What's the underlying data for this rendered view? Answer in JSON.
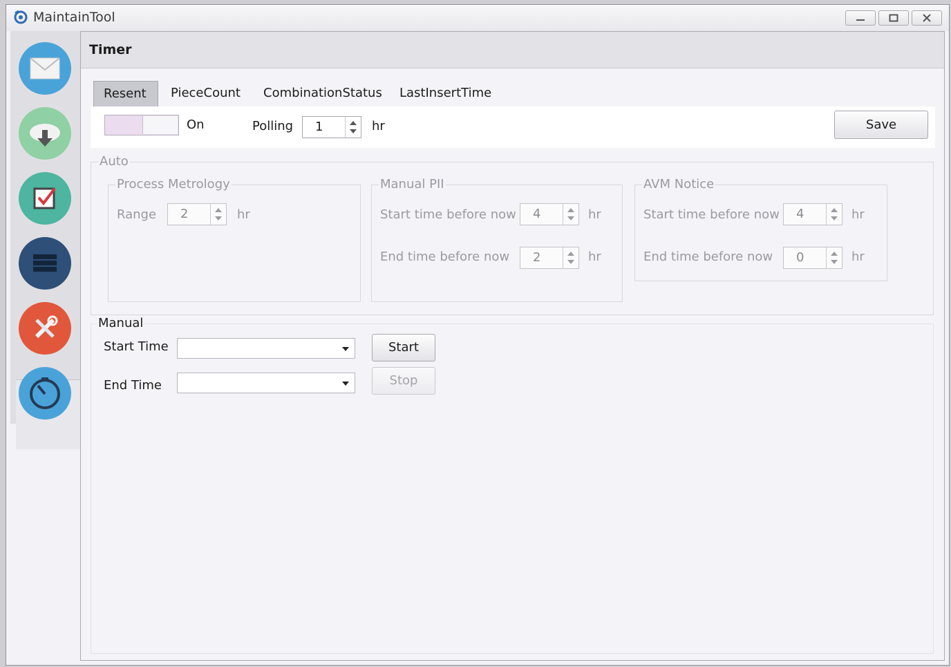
{
  "window": {
    "title": "MaintainTool",
    "controls": [
      "minimize",
      "maximize",
      "close"
    ]
  },
  "sidebar": {
    "items": [
      {
        "icon": "mail-icon",
        "color": "#4aa3d8"
      },
      {
        "icon": "cloud-download-icon",
        "color": "#8fd0a4"
      },
      {
        "icon": "checkbox-icon",
        "color": "#4db5a0"
      },
      {
        "icon": "server-list-icon",
        "color": "#2d4f78"
      },
      {
        "icon": "tools-icon",
        "color": "#e1573b"
      },
      {
        "icon": "timer-icon",
        "color": "#4aa3d8"
      }
    ]
  },
  "page": {
    "title": "Timer"
  },
  "tabs": [
    {
      "label": "Resent",
      "active": true
    },
    {
      "label": "PieceCount",
      "active": false
    },
    {
      "label": "CombinationStatus",
      "active": false
    },
    {
      "label": "LastInsertTime",
      "active": false
    }
  ],
  "toprow": {
    "toggle_label": "On",
    "polling_label": "Polling",
    "polling_value": "1",
    "polling_unit": "hr",
    "save_label": "Save"
  },
  "auto": {
    "title": "Auto",
    "process_metrology": {
      "title": "Process  Metrology",
      "range_label": "Range",
      "range_value": "2",
      "unit": "hr"
    },
    "manual_pii": {
      "title": "Manual PII",
      "start_label": "Start time before now",
      "start_value": "4",
      "end_label": "End time before now",
      "end_value": "2",
      "unit": "hr"
    },
    "avm_notice": {
      "title": "AVM Notice",
      "start_label": "Start time before now",
      "start_value": "4",
      "end_label": "End time before now",
      "end_value": "0",
      "unit": "hr"
    }
  },
  "manual": {
    "title": "Manual",
    "start_time_label": "Start Time",
    "start_time_value": "",
    "end_time_label": "End Time",
    "end_time_value": "",
    "start_button": "Start",
    "stop_button": "Stop"
  },
  "colors": {
    "toggle_track": "#ecdcf0",
    "active_tab": "#c8c8cf",
    "dim_text": "#9a9aa0"
  }
}
